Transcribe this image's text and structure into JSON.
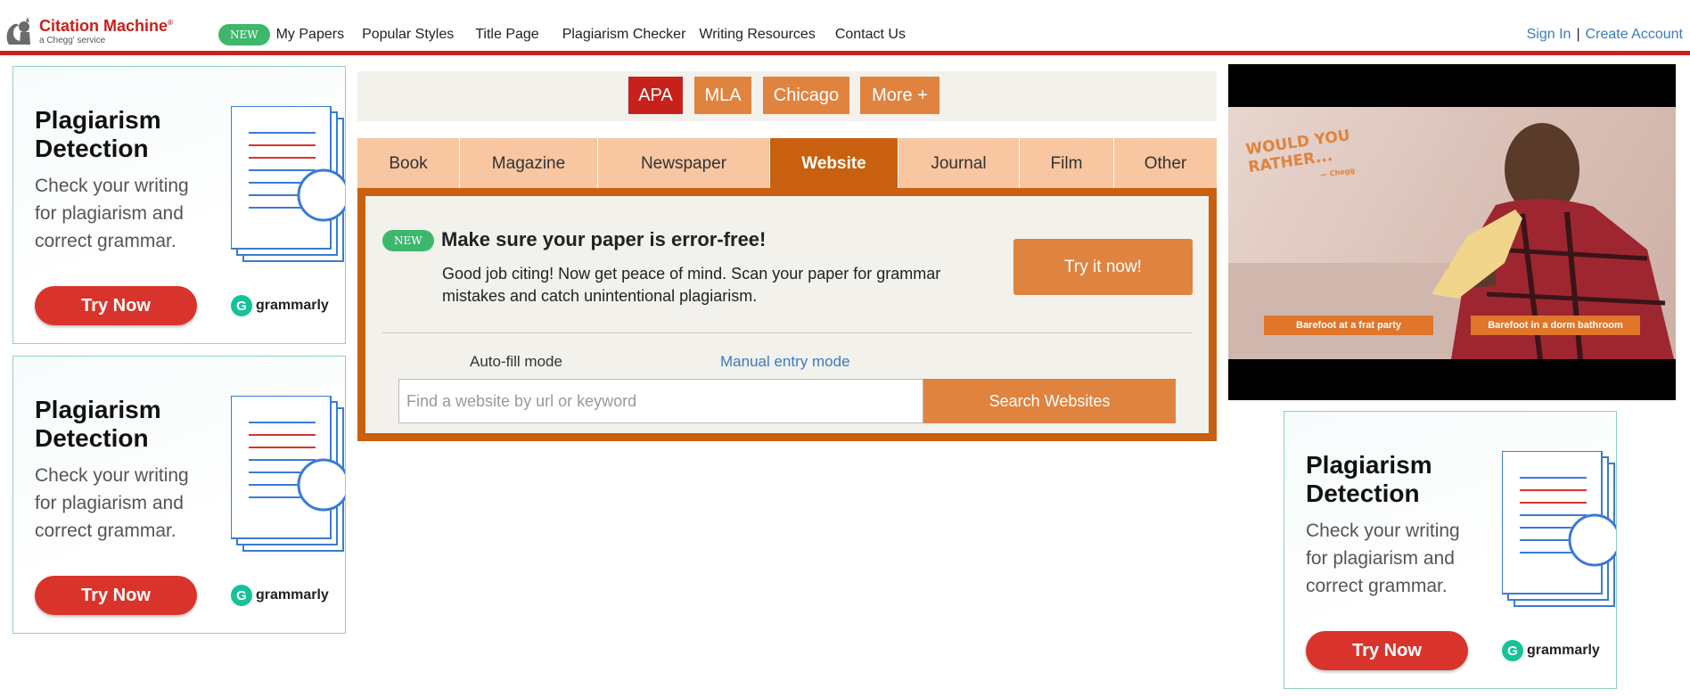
{
  "header": {
    "brand": "Citation Machine",
    "brand_mark": "®",
    "brand_sub": "a Chegg' service",
    "new_badge": "NEW",
    "nav": [
      "My Papers",
      "Popular Styles",
      "Title Page",
      "Plagiarism Checker",
      "Writing Resources",
      "Contact Us"
    ],
    "sign_in": "Sign In",
    "separator": "|",
    "create_account": "Create Account"
  },
  "styles": [
    {
      "label": "APA",
      "active": true
    },
    {
      "label": "MLA",
      "active": false
    },
    {
      "label": "Chicago",
      "active": false
    },
    {
      "label": "More +",
      "active": false
    }
  ],
  "tabs": [
    {
      "label": "Book",
      "active": false
    },
    {
      "label": "Magazine",
      "active": false
    },
    {
      "label": "Newspaper",
      "active": false
    },
    {
      "label": "Website",
      "active": true
    },
    {
      "label": "Journal",
      "active": false
    },
    {
      "label": "Film",
      "active": false
    },
    {
      "label": "Other",
      "active": false
    }
  ],
  "promo": {
    "badge": "NEW",
    "title": "Make sure your paper is error-free!",
    "body": "Good job citing! Now get peace of mind. Scan your paper for grammar mistakes and catch unintentional plagiarism.",
    "button": "Try it now!"
  },
  "search": {
    "mode_auto": "Auto-fill mode",
    "mode_manual": "Manual entry mode",
    "placeholder": "Find a website by url or keyword",
    "value": "",
    "button": "Search Websites"
  },
  "ad": {
    "title": "Plagiarism Detection",
    "body": "Check your writing for plagiarism and correct grammar.",
    "button": "Try Now",
    "brand": "grammarly"
  },
  "video": {
    "logo_line1": "WOULD YOU",
    "logo_line2": "RATHER...",
    "logo_sub": "— Chegg",
    "option_left": "Barefoot at a frat party",
    "option_right": "Barefoot in a dorm bathroom"
  },
  "colors": {
    "brand_red": "#c8201b",
    "accent_orange": "#e0833f",
    "tab_active": "#c8600f",
    "tab_inactive": "#f8c6a0",
    "new_green": "#3db86b",
    "link_blue": "#3a7bbf",
    "grammarly_green": "#15c39a"
  },
  "icons": {
    "logo": "squirrel-icon",
    "grammarly": "grammarly-g-icon",
    "ad_art": "document-stack-icon"
  }
}
